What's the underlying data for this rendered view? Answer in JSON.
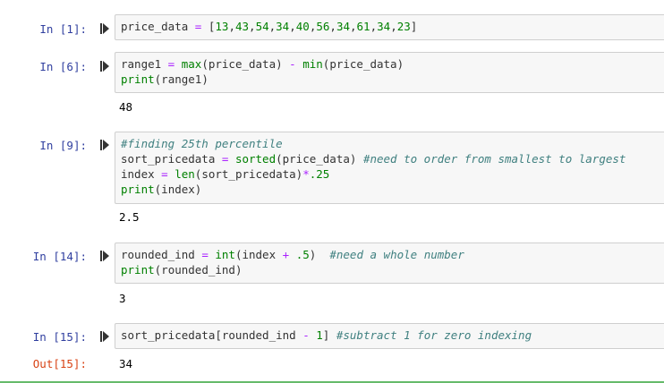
{
  "cells": [
    {
      "prompt": "In [1]:",
      "lines": [
        [
          {
            "t": "price_data",
            "k": "p"
          },
          {
            "t": " = ",
            "k": "op"
          },
          {
            "t": "[",
            "k": "p"
          },
          {
            "t": "13",
            "k": "num"
          },
          {
            "t": ",",
            "k": "p"
          },
          {
            "t": "43",
            "k": "num"
          },
          {
            "t": ",",
            "k": "p"
          },
          {
            "t": "54",
            "k": "num"
          },
          {
            "t": ",",
            "k": "p"
          },
          {
            "t": "34",
            "k": "num"
          },
          {
            "t": ",",
            "k": "p"
          },
          {
            "t": "40",
            "k": "num"
          },
          {
            "t": ",",
            "k": "p"
          },
          {
            "t": "56",
            "k": "num"
          },
          {
            "t": ",",
            "k": "p"
          },
          {
            "t": "34",
            "k": "num"
          },
          {
            "t": ",",
            "k": "p"
          },
          {
            "t": "61",
            "k": "num"
          },
          {
            "t": ",",
            "k": "p"
          },
          {
            "t": "34",
            "k": "num"
          },
          {
            "t": ",",
            "k": "p"
          },
          {
            "t": "23",
            "k": "num"
          },
          {
            "t": "]",
            "k": "p"
          }
        ]
      ],
      "output": null
    },
    {
      "prompt": "In [6]:",
      "lines": [
        [
          {
            "t": "range1",
            "k": "p"
          },
          {
            "t": " = ",
            "k": "op"
          },
          {
            "t": "max",
            "k": "fn"
          },
          {
            "t": "(price_data) ",
            "k": "p"
          },
          {
            "t": "-",
            "k": "op"
          },
          {
            "t": " ",
            "k": "p"
          },
          {
            "t": "min",
            "k": "fn"
          },
          {
            "t": "(price_data)",
            "k": "p"
          }
        ],
        [
          {
            "t": "print",
            "k": "fn"
          },
          {
            "t": "(range1)",
            "k": "p"
          }
        ]
      ],
      "output": "48"
    },
    {
      "prompt": "In [9]:",
      "lines": [
        [
          {
            "t": "#finding 25th percentile",
            "k": "cm"
          }
        ],
        [
          {
            "t": "sort_pricedata",
            "k": "p"
          },
          {
            "t": " = ",
            "k": "op"
          },
          {
            "t": "sorted",
            "k": "fn"
          },
          {
            "t": "(price_data) ",
            "k": "p"
          },
          {
            "t": "#need to order from smallest to largest",
            "k": "cm"
          }
        ],
        [
          {
            "t": "index",
            "k": "p"
          },
          {
            "t": " = ",
            "k": "op"
          },
          {
            "t": "len",
            "k": "fn"
          },
          {
            "t": "(sort_pricedata)",
            "k": "p"
          },
          {
            "t": "*",
            "k": "op"
          },
          {
            "t": ".25",
            "k": "num"
          }
        ],
        [
          {
            "t": "print",
            "k": "fn"
          },
          {
            "t": "(index)",
            "k": "p"
          }
        ]
      ],
      "output": "2.5"
    },
    {
      "prompt": "In [14]:",
      "lines": [
        [
          {
            "t": "rounded_ind",
            "k": "p"
          },
          {
            "t": " = ",
            "k": "op"
          },
          {
            "t": "int",
            "k": "fn"
          },
          {
            "t": "(index ",
            "k": "p"
          },
          {
            "t": "+",
            "k": "op"
          },
          {
            "t": " ",
            "k": "p"
          },
          {
            "t": ".5",
            "k": "num"
          },
          {
            "t": ")  ",
            "k": "p"
          },
          {
            "t": "#need a whole number",
            "k": "cm"
          }
        ],
        [
          {
            "t": "print",
            "k": "fn"
          },
          {
            "t": "(rounded_ind)",
            "k": "p"
          }
        ]
      ],
      "output": "3"
    },
    {
      "prompt": "In [15]:",
      "lines": [
        [
          {
            "t": "sort_pricedata[rounded_ind ",
            "k": "p"
          },
          {
            "t": "-",
            "k": "op"
          },
          {
            "t": " ",
            "k": "p"
          },
          {
            "t": "1",
            "k": "num"
          },
          {
            "t": "] ",
            "k": "p"
          },
          {
            "t": "#subtract 1 for zero indexing",
            "k": "cm"
          }
        ]
      ],
      "out_prompt": "Out[15]:",
      "output": "34"
    }
  ],
  "colors": {
    "in_prompt": "#303f9f",
    "out_prompt": "#d84315",
    "function": "#008000",
    "operator": "#aa22ff",
    "comment": "#408080",
    "cell_background": "#f7f7f7",
    "cell_border": "#cfcfcf"
  },
  "icons": {
    "run": "run-cell-icon"
  }
}
